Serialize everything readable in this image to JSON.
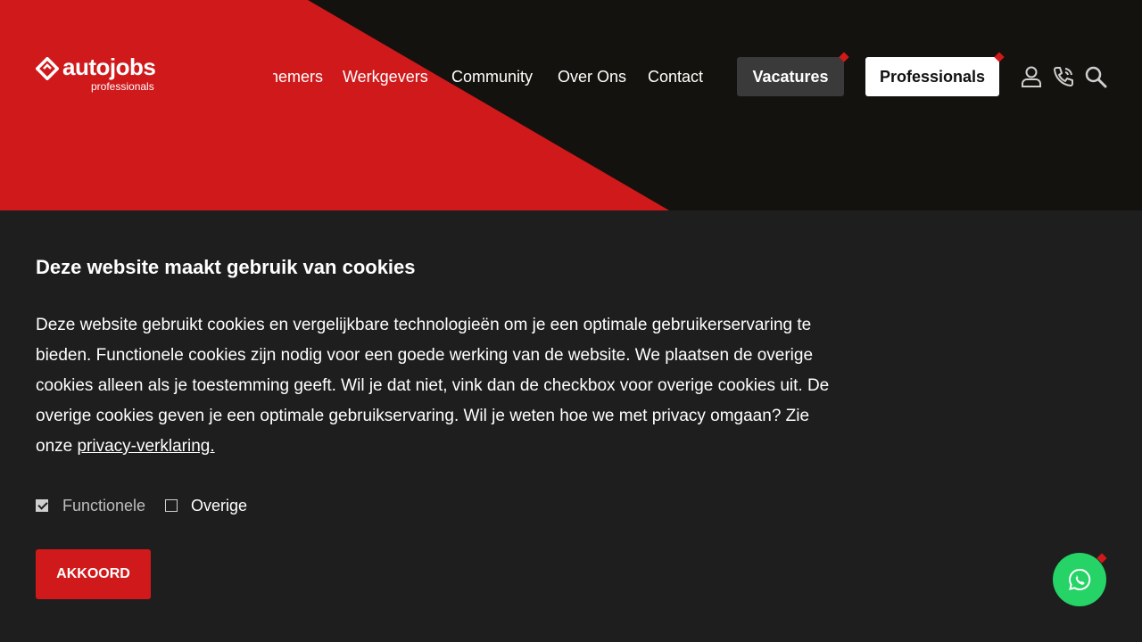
{
  "brand": {
    "name": "autojobs",
    "sub": "professionals"
  },
  "nav": {
    "items": [
      "nemers",
      "Werkgevers",
      "Community",
      "Over Ons",
      "Contact"
    ],
    "vacatures": "Vacatures",
    "professionals": "Professionals"
  },
  "icons": [
    "user-icon",
    "phone-icon",
    "search-icon",
    "whatsapp-icon"
  ],
  "cookie": {
    "title": "Deze website maakt gebruik van cookies",
    "body": "Deze website gebruikt cookies en vergelijkbare technologieën om je een optimale gebruikerservaring te bieden. Functionele cookies zijn nodig voor een goede werking van de website. We plaatsen de overige cookies alleen als je toestemming geeft. Wil je dat niet, vink dan de checkbox voor overige cookies uit. De overige cookies geven je een optimale gebruikservaring. Wil je weten hoe we met privacy omgaan? Zie onze ",
    "link": "privacy-verklaring.",
    "option_functional": "Functionele",
    "option_functional_checked": true,
    "option_other": "Overige",
    "option_other_checked": false,
    "accept": "AKKOORD"
  },
  "colors": {
    "accent_red": "#d0191b",
    "header_dark": "#14120e",
    "page_bg": "#1e1e1e",
    "whatsapp_green": "#25d366"
  }
}
